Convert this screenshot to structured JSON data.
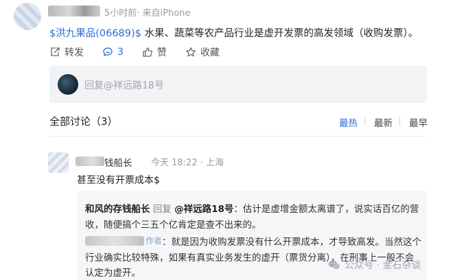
{
  "post": {
    "meta": "5小时前· 来自iPhone",
    "stock_tag": "$洪九果品(06689)$",
    "text": " 水果、蔬菜等农产品行业是虚开发票的高发领域（收购发票）。"
  },
  "actions": {
    "repost": "转发",
    "comment_count": "3",
    "like": "赞",
    "favorite": "收藏"
  },
  "reply_box": {
    "placeholder": "回复@祥远路18号"
  },
  "discussion": {
    "title": "全部讨论（3）",
    "sort": [
      "最热",
      "最新",
      "最早"
    ],
    "active_sort": "最热"
  },
  "comment": {
    "name_suffix": "钱船长",
    "meta": "今天 18:22 · 上海",
    "text": "甚至没有开票成本$"
  },
  "quote": {
    "author": "和风的存钱船长",
    "reply_word": "回复",
    "target": "@祥远路18号",
    "colon": "：",
    "line1": "估计是虚增金额太离谱了，说实话百亿的营",
    "line2": "收，随便搞个三五个亿肯定是查不出来的。",
    "author_tag": "作者",
    "reply2_line1": "：就是因为收购发票没有什么开票成本，才导致高发。当然这个",
    "reply2_line2": "行业确实比较特殊，如果有真实业务发生的虚开（票货分离），在刑事上一般不会",
    "reply2_line3": "认定为虚开。"
  },
  "watermark": "公众号 · 金石杂谈",
  "colors": {
    "link": "#2a6bd6",
    "muted": "#9a9a9a"
  }
}
